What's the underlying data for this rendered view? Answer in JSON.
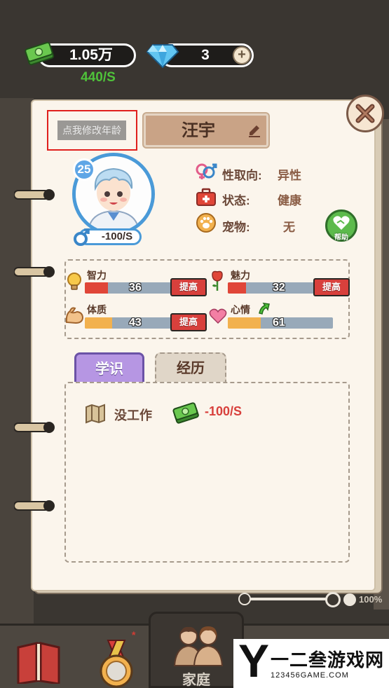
{
  "currency": {
    "cash": "1.05万",
    "cash_rate": "440/S",
    "gems": "3",
    "gem_plus": "+"
  },
  "profile": {
    "age_placeholder": "点我修改年龄",
    "name": "汪宇",
    "level": "25",
    "income": "-100/S",
    "info": [
      {
        "label": "性取向:",
        "value": "异性",
        "icon": "gender-symbol-icon"
      },
      {
        "label": "状态:",
        "value": "健康",
        "icon": "medical-kit-icon"
      },
      {
        "label": "宠物:",
        "value": "无",
        "icon": "paw-icon"
      }
    ],
    "help_label": "帮助"
  },
  "stats": [
    {
      "label": "智力",
      "value": "36",
      "fraction": 0.25,
      "color": "#e04638",
      "icon": "lightbulb-icon",
      "button": "提高"
    },
    {
      "label": "魅力",
      "value": "32",
      "fraction": 0.2,
      "color": "#e04638",
      "icon": "rose-icon",
      "button": "提高"
    },
    {
      "label": "体质",
      "value": "43",
      "fraction": 0.3,
      "color": "#f2b14e",
      "icon": "muscle-arm-icon",
      "button": "提高"
    },
    {
      "label": "心情",
      "value": "61",
      "fraction": 0.31,
      "color": "#f2b14e",
      "icon": "heart-icon",
      "trend_icon": "up-arrow-icon"
    }
  ],
  "tabs": {
    "education": "学识",
    "experience": "经历"
  },
  "job": {
    "label": "没工作",
    "rate": "-100/S"
  },
  "zoom": "100%",
  "nav": {
    "family": "家庭"
  },
  "watermark": {
    "logo": "Y",
    "title": "一二叁游戏网",
    "url": "123456GAME.COM"
  }
}
